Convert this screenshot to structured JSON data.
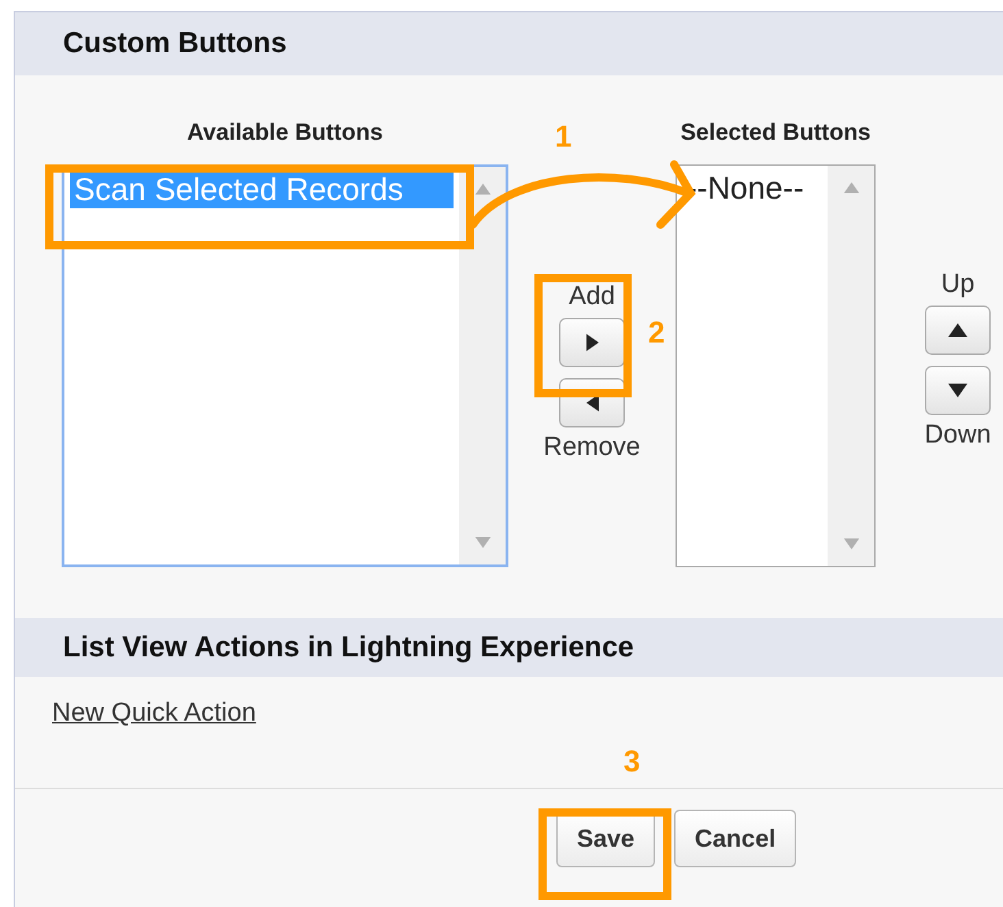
{
  "custom_buttons": {
    "title": "Custom Buttons",
    "available": {
      "label": "Available Buttons",
      "options": [
        {
          "text": "Scan Selected Records",
          "selected": true
        }
      ]
    },
    "add": {
      "label": "Add"
    },
    "remove": {
      "label": "Remove"
    },
    "selected": {
      "label": "Selected Buttons",
      "options": [
        {
          "text": "--None--",
          "selected": false
        }
      ]
    },
    "up": {
      "label": "Up"
    },
    "down": {
      "label": "Down"
    }
  },
  "list_view_actions": {
    "title": "List View Actions in Lightning Experience",
    "link": "New Quick Action"
  },
  "footer": {
    "buttons": [
      {
        "label": "Save"
      },
      {
        "label": "Cancel"
      }
    ]
  },
  "annotations": [
    {
      "number": "1"
    },
    {
      "number": "2"
    },
    {
      "number": "3"
    }
  ]
}
